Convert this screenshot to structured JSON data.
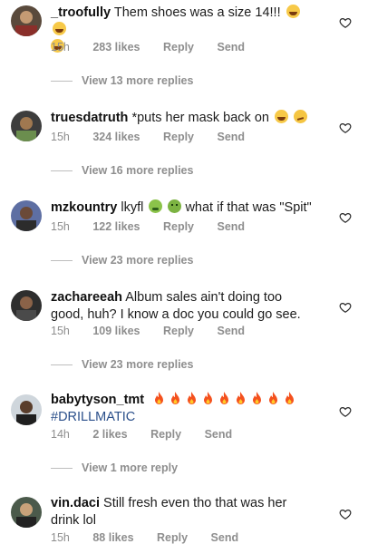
{
  "comments": [
    {
      "username": "_troofully",
      "text": "Them shoes was a size 14!!!",
      "emojis": [
        "laughing-tears-emoji",
        "laughing-tears-emoji",
        "laughing-tears-emoji"
      ],
      "time": "15h",
      "likes": "283 likes",
      "reply": "Reply",
      "send": "Send",
      "view_more": "View 13 more replies"
    },
    {
      "username": "truesdatruth",
      "text": "*puts her mask back on",
      "emojis": [
        "laughing-tears-emoji",
        "smirk-emoji"
      ],
      "time": "15h",
      "likes": "324 likes",
      "reply": "Reply",
      "send": "Send",
      "view_more": "View 16 more replies"
    },
    {
      "username": "mzkountry",
      "text_before": "lkyfl",
      "text_after": "what if that was \"Spit\"",
      "emojis": [
        "nauseated-emoji",
        "green-face-emoji"
      ],
      "time": "15h",
      "likes": "122 likes",
      "reply": "Reply",
      "send": "Send",
      "view_more": "View 23 more replies"
    },
    {
      "username": "zachareeah",
      "text": "Album sales ain't doing too good, huh? I know a doc you could go see.",
      "time": "15h",
      "likes": "109 likes",
      "reply": "Reply",
      "send": "Send",
      "view_more": "View 23 more replies"
    },
    {
      "username": "babytyson_tmt",
      "fire_count": 9,
      "hashtag": "#DRILLMATIC",
      "time": "14h",
      "likes": "2 likes",
      "reply": "Reply",
      "send": "Send",
      "view_more": "View 1 more reply"
    },
    {
      "username": "vin.daci",
      "text": "Still fresh even tho that was her drink lol",
      "time": "15h",
      "likes": "88 likes",
      "reply": "Reply",
      "send": "Send"
    }
  ],
  "colors": {
    "meta": "#8e8e8e",
    "hashtag": "#2a4f8a",
    "fire": "#f4511e"
  }
}
